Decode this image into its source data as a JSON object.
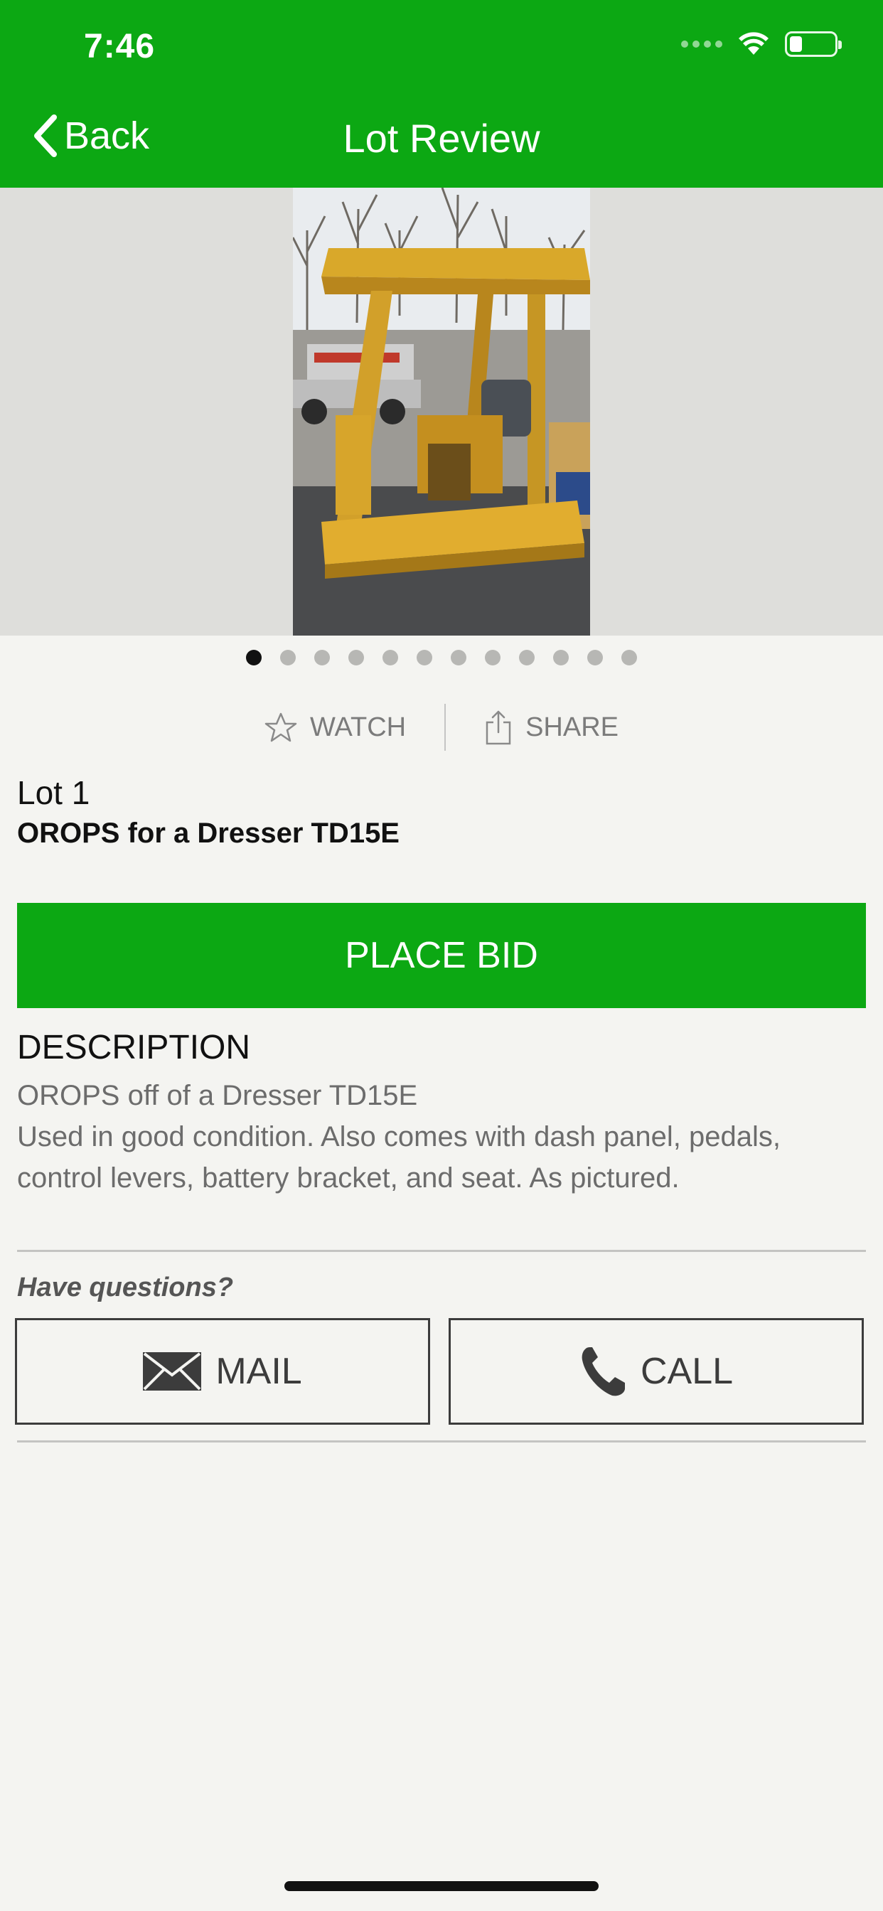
{
  "status_bar": {
    "time": "7:46",
    "battery_level": 0.25
  },
  "nav": {
    "back_label": "Back",
    "title": "Lot Review"
  },
  "gallery": {
    "image_count": 12,
    "active_index": 0
  },
  "actions": {
    "watch_label": "WATCH",
    "share_label": "SHARE"
  },
  "lot": {
    "number": "Lot 1",
    "title": "OROPS for a Dresser TD15E"
  },
  "bid": {
    "label": "PLACE BID"
  },
  "description": {
    "heading": "DESCRIPTION",
    "line1": "OROPS off of a Dresser TD15E",
    "body": "Used in good condition. Also comes with dash panel, pedals, control levers, battery bracket, and seat. As pictured."
  },
  "contact": {
    "prompt": "Have questions?",
    "mail_label": "MAIL",
    "call_label": "CALL"
  },
  "colors": {
    "brand_green": "#0ca813",
    "background": "#f4f4f1"
  },
  "icons": [
    "chevron-left-icon",
    "wifi-icon",
    "battery-icon",
    "star-icon",
    "share-icon",
    "mail-icon",
    "phone-icon"
  ]
}
